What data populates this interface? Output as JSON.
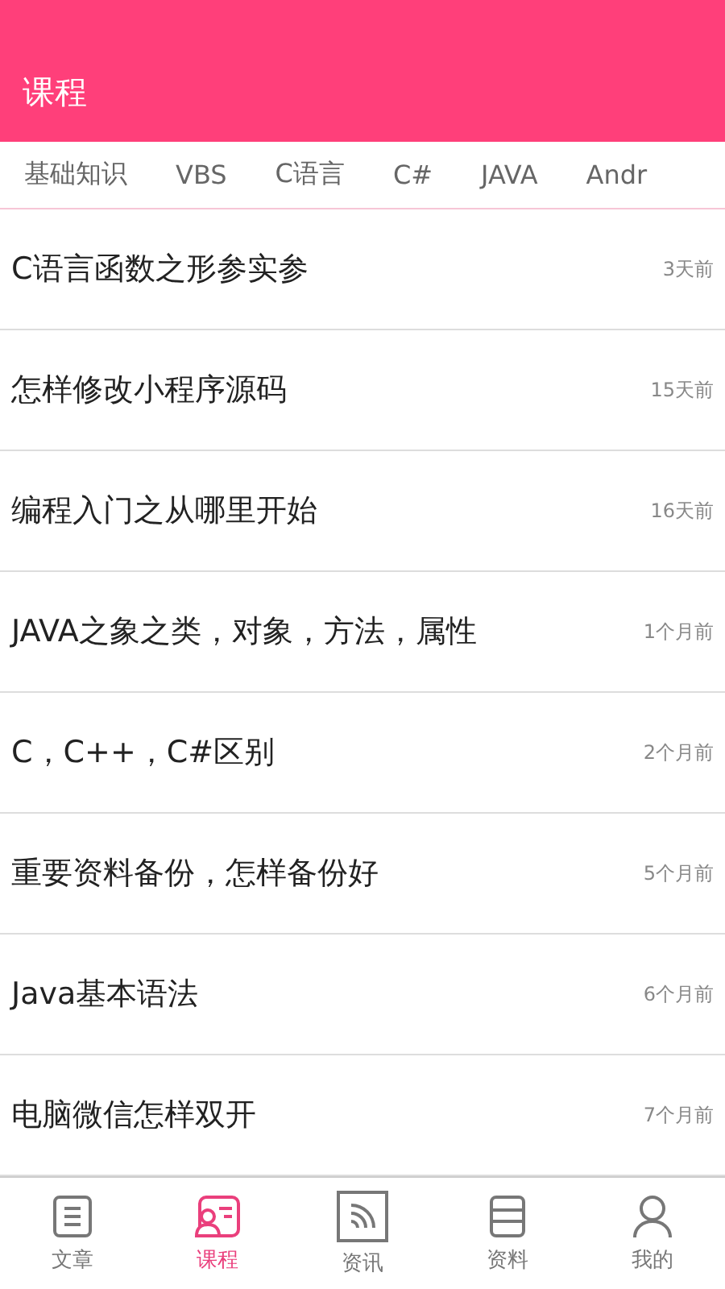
{
  "header": {
    "title": "课程"
  },
  "tabs": [
    "基础知识",
    "VBS",
    "C语言",
    "C#",
    "JAVA",
    "Andr"
  ],
  "articles": [
    {
      "title": "C语言函数之形参实参",
      "time": "3天前"
    },
    {
      "title": "怎样修改小程序源码",
      "time": "15天前"
    },
    {
      "title": "编程入门之从哪里开始",
      "time": "16天前"
    },
    {
      "title": "JAVA之象之类，对象，方法，属性",
      "time": "1个月前"
    },
    {
      "title": "C，C++，C#区别",
      "time": "2个月前"
    },
    {
      "title": "重要资料备份，怎样备份好",
      "time": "5个月前"
    },
    {
      "title": "Java基本语法",
      "time": "6个月前"
    },
    {
      "title": "电脑微信怎样双开",
      "time": "7个月前"
    }
  ],
  "bottom_nav": [
    {
      "label": "文章",
      "kind": "article",
      "selected": false
    },
    {
      "label": "课程",
      "kind": "course",
      "selected": true
    },
    {
      "label": "资讯",
      "kind": "news",
      "selected": false
    },
    {
      "label": "资料",
      "kind": "docs",
      "selected": false
    },
    {
      "label": "我的",
      "kind": "profile",
      "selected": false
    }
  ]
}
